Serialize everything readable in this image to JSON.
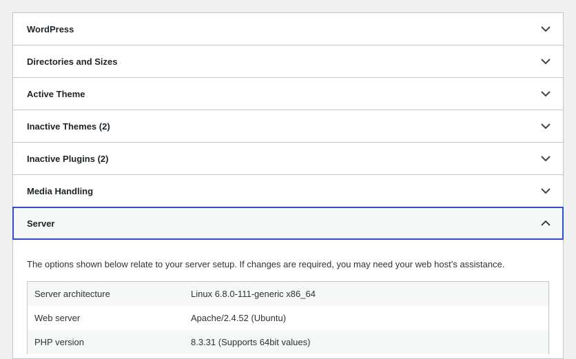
{
  "sections": [
    {
      "label": "WordPress"
    },
    {
      "label": "Directories and Sizes"
    },
    {
      "label": "Active Theme"
    },
    {
      "label": "Inactive Themes (2)"
    },
    {
      "label": "Inactive Plugins (2)"
    },
    {
      "label": "Media Handling"
    }
  ],
  "server": {
    "label": "Server",
    "description": "The options shown below relate to your server setup. If changes are required, you may need your web host’s assistance.",
    "rows": [
      {
        "key": "Server architecture",
        "value": "Linux 6.8.0-111-generic x86_64"
      },
      {
        "key": "Web server",
        "value": "Apache/2.4.52 (Ubuntu)"
      },
      {
        "key": "PHP version",
        "value": "8.3.31 (Supports 64bit values)"
      }
    ]
  },
  "icons": {
    "collapsed": "chevron-down-icon",
    "expanded": "chevron-up-icon"
  },
  "colors": {
    "focus_border": "#2c4fcf",
    "border": "#c3c4c7",
    "background": "#f0f0f1"
  }
}
